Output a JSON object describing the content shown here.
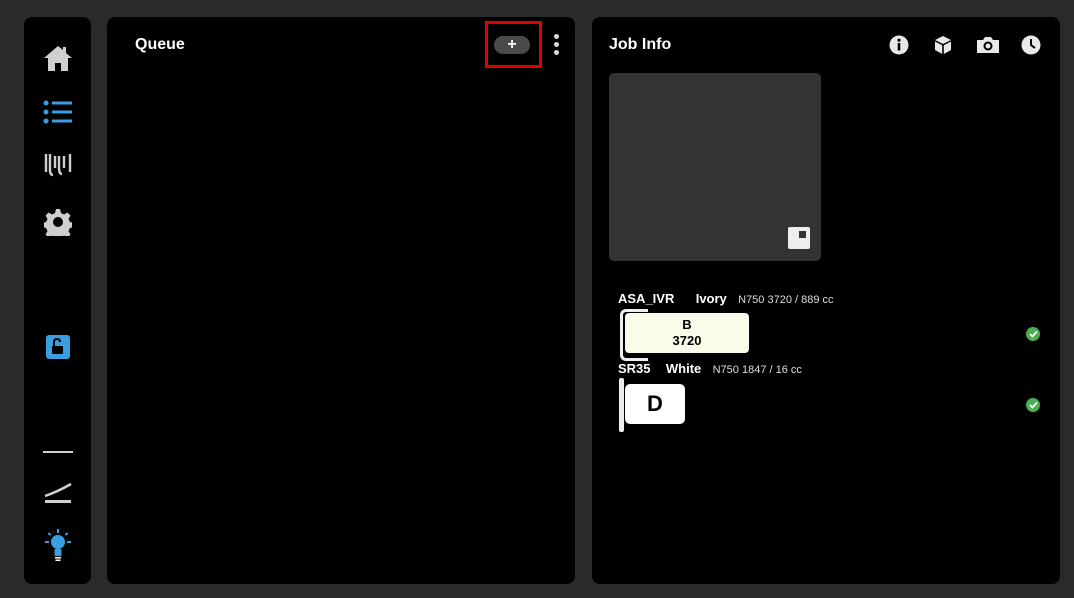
{
  "sidebar": {
    "items": [
      {
        "icon": "home-icon"
      },
      {
        "icon": "list-icon"
      },
      {
        "icon": "filament-icon"
      },
      {
        "icon": "gear-icon"
      },
      {
        "icon": "unlock-icon"
      },
      {
        "icon": "line-icon"
      },
      {
        "icon": "build-plate-icon"
      },
      {
        "icon": "lightbulb-icon"
      }
    ],
    "accent": "#3a9fe0"
  },
  "queue": {
    "title": "Queue",
    "add_label": "+",
    "highlight_color": "#e00000"
  },
  "job_info": {
    "title": "Job Info",
    "header_icons": [
      "info-icon",
      "cube-icon",
      "camera-icon",
      "clock-icon"
    ],
    "materials": [
      {
        "name": "ASA_IVR",
        "color": "Ivory",
        "info": "N750 3720 / 889 cc",
        "spool_letter": "B",
        "spool_number": "3720",
        "status": "ok"
      },
      {
        "name": "SR35",
        "color": "White",
        "info": "N750 1847 / 16 cc",
        "spool_letter": "D",
        "status": "ok"
      }
    ],
    "status_color": "#4caf50"
  }
}
